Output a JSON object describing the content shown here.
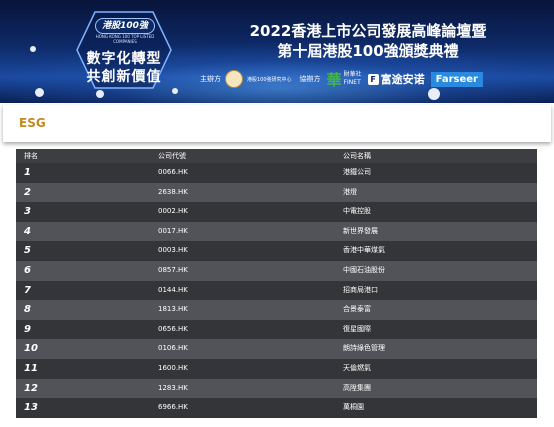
{
  "banner": {
    "logo_badge": "港股100強",
    "logo_sub": "HONG KONG 100 TOP LISTED COMPANIES",
    "logo_line1": "數字化轉型",
    "logo_line2": "共創新價值",
    "title_line1": "2022香港上市公司發展高峰論壇暨",
    "title_line2": "第十屆港股100強頒獎典禮",
    "organizer_label": "主辦方",
    "organizer_name": "港股100強研究中心",
    "coorganizer_label": "協辦方",
    "cjs_name": "財華社",
    "cjs_sub": "FINET",
    "futu_name": "富途安诺",
    "farseer_name": "Farseer"
  },
  "section": {
    "title": "ESG"
  },
  "table": {
    "headers": [
      "排名",
      "公司代號",
      "公司名稱"
    ],
    "rows": [
      {
        "rank": "1",
        "code": "0066.HK",
        "name": "港鐵公司"
      },
      {
        "rank": "2",
        "code": "2638.HK",
        "name": "港燈"
      },
      {
        "rank": "3",
        "code": "0002.HK",
        "name": "中電控股"
      },
      {
        "rank": "4",
        "code": "0017.HK",
        "name": "新世界發展"
      },
      {
        "rank": "5",
        "code": "0003.HK",
        "name": "香港中華煤氣"
      },
      {
        "rank": "6",
        "code": "0857.HK",
        "name": "中國石油股份"
      },
      {
        "rank": "7",
        "code": "0144.HK",
        "name": "招商局港口"
      },
      {
        "rank": "8",
        "code": "1813.HK",
        "name": "合景泰富"
      },
      {
        "rank": "9",
        "code": "0656.HK",
        "name": "復星國際"
      },
      {
        "rank": "10",
        "code": "0106.HK",
        "name": "朗詩綠色管理"
      },
      {
        "rank": "11",
        "code": "1600.HK",
        "name": "天倫燃氣"
      },
      {
        "rank": "12",
        "code": "1283.HK",
        "name": "高陞集團"
      },
      {
        "rank": "13",
        "code": "6966.HK",
        "name": "萬桐園"
      }
    ]
  }
}
